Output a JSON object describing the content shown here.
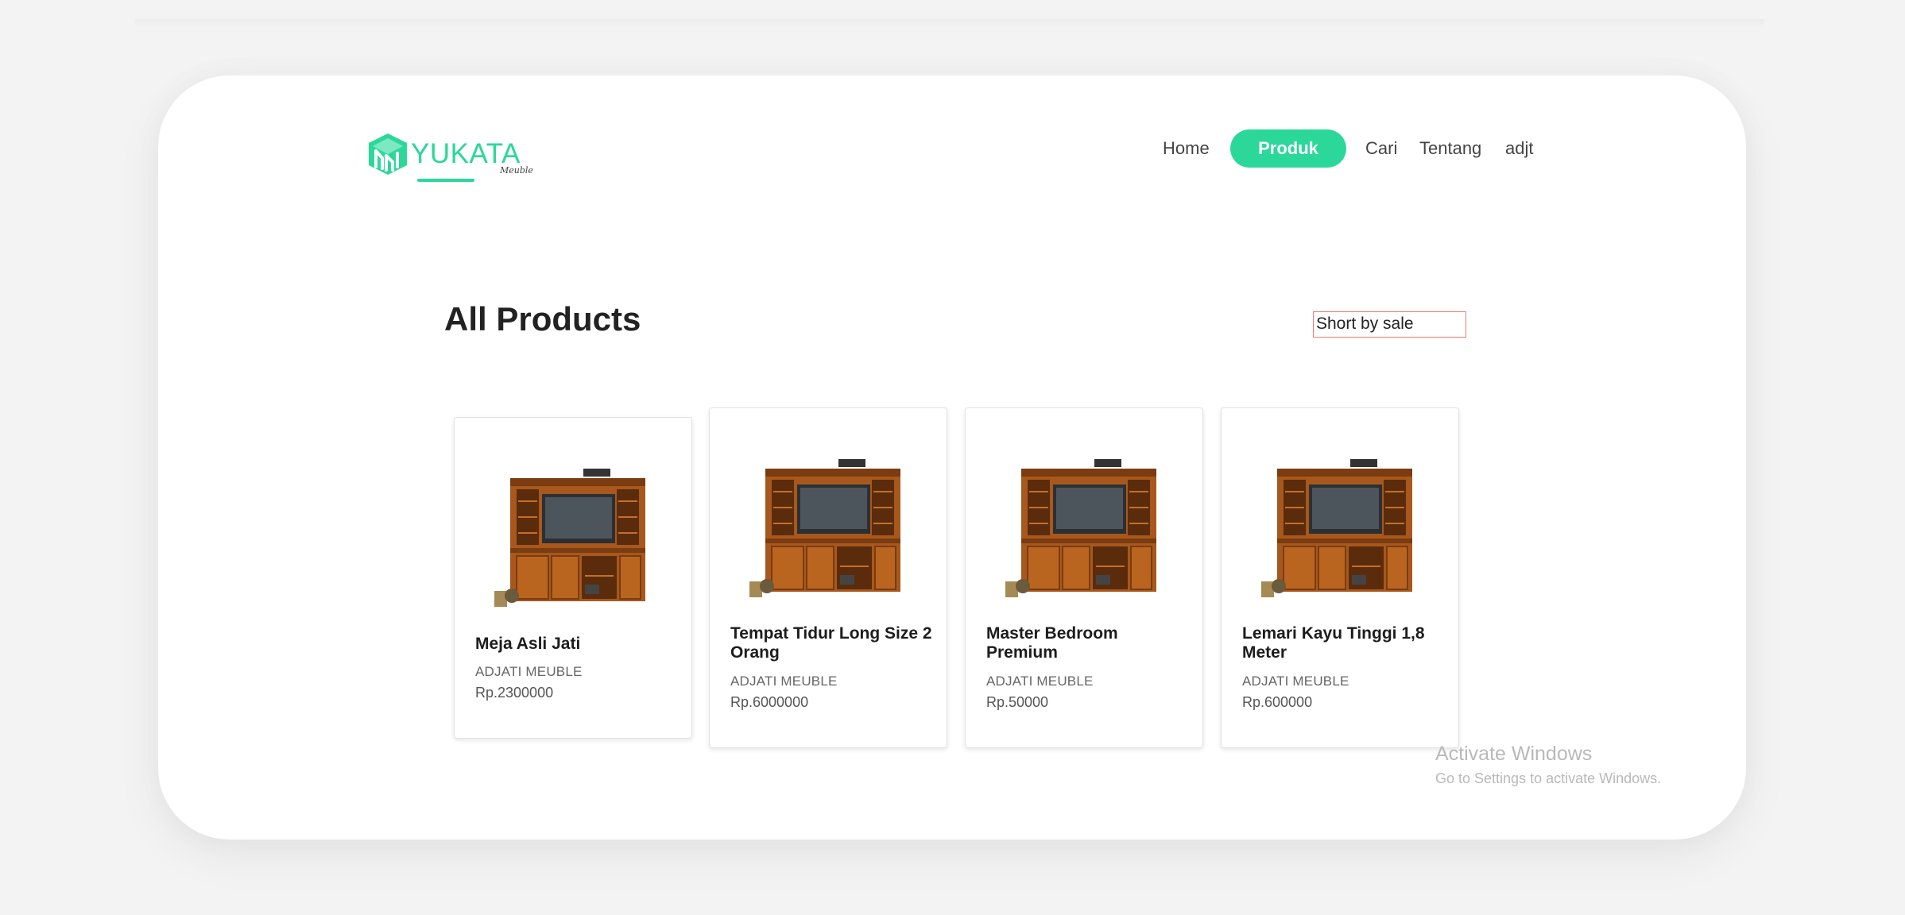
{
  "brand": {
    "name": "YUKATA",
    "tagline": "Meuble",
    "accent_color": "#2bd89a"
  },
  "nav": {
    "items": [
      {
        "label": "Home",
        "active": false
      },
      {
        "label": "Produk",
        "active": true
      },
      {
        "label": "Cari",
        "active": false
      },
      {
        "label": "Tentang",
        "active": false
      },
      {
        "label": "adjt",
        "active": false
      }
    ]
  },
  "main": {
    "title": "All Products",
    "sort": {
      "selected": "Short by sale"
    }
  },
  "products": [
    {
      "name": "Meja Asli Jati",
      "brand": "ADJATI MEUBLE",
      "price": "Rp.2300000",
      "image": "tv-cabinet-image"
    },
    {
      "name": "Tempat Tidur Long Size 2 Orang",
      "brand": "ADJATI MEUBLE",
      "price": "Rp.6000000",
      "image": "tv-cabinet-image"
    },
    {
      "name": "Master Bedroom Premium",
      "brand": "ADJATI MEUBLE",
      "price": "Rp.50000",
      "image": "tv-cabinet-image"
    },
    {
      "name": "Lemari Kayu Tinggi 1,8 Meter",
      "brand": "ADJATI MEUBLE",
      "price": "Rp.600000",
      "image": "tv-cabinet-image"
    }
  ],
  "watermark": {
    "title": "Activate Windows",
    "subtitle": "Go to Settings to activate Windows."
  }
}
